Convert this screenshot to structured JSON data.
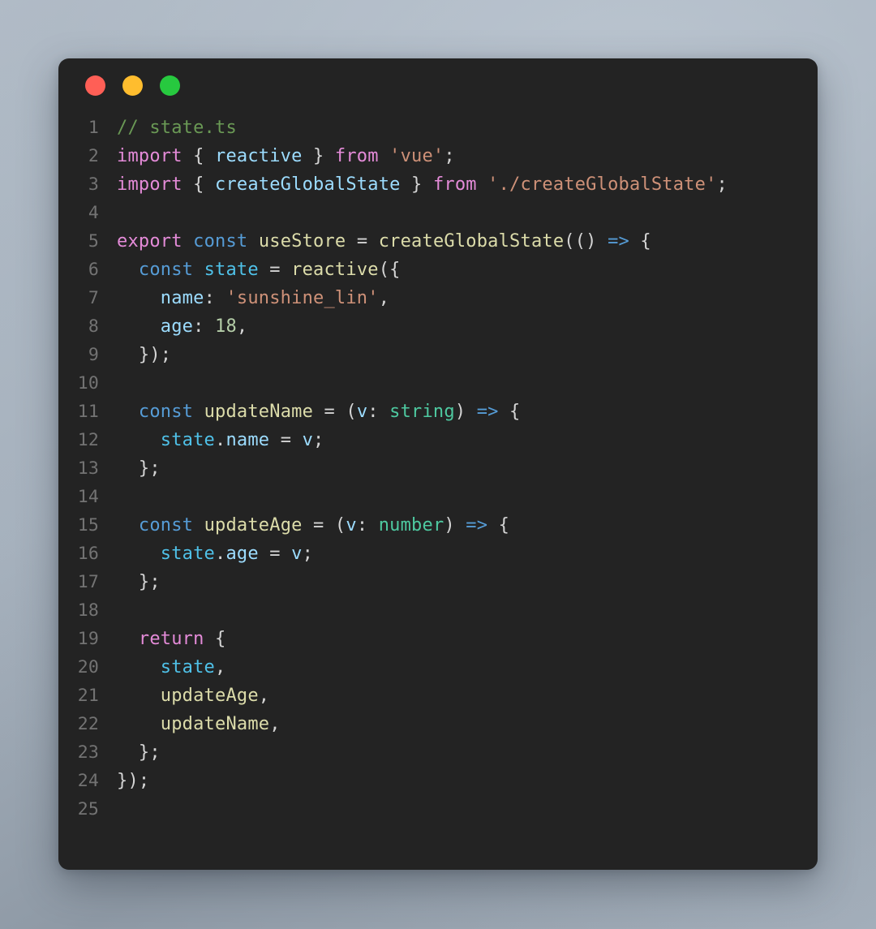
{
  "window": {
    "background_color": "#232323",
    "page_background_color": "#a8b4c0",
    "controls": [
      {
        "name": "close",
        "color": "#ff5f56"
      },
      {
        "name": "minimize",
        "color": "#ffbd2e"
      },
      {
        "name": "maximize",
        "color": "#27c93f"
      }
    ]
  },
  "editor": {
    "language": "typescript",
    "filename": "state.ts",
    "line_number_color": "#737373",
    "theme": {
      "comment": "#6a9955",
      "keyword": "#e48bd8",
      "storage": "#569cd6",
      "function": "#dcdcaa",
      "variable": "#9cdcfe",
      "variable_bright": "#4fc1e8",
      "string": "#ce9178",
      "number": "#b5cea8",
      "type": "#4ec9a0",
      "arrow": "#569cd6",
      "punctuation": "#d4d4d4"
    },
    "line_numbers": [
      "1",
      "2",
      "3",
      "4",
      "5",
      "6",
      "7",
      "8",
      "9",
      "10",
      "11",
      "12",
      "13",
      "14",
      "15",
      "16",
      "17",
      "18",
      "19",
      "20",
      "21",
      "22",
      "23",
      "24",
      "25"
    ],
    "lines": [
      {
        "n": "1",
        "text": "// state.ts"
      },
      {
        "n": "2",
        "text": "import { reactive } from 'vue';"
      },
      {
        "n": "3",
        "text": "import { createGlobalState } from './createGlobalState';"
      },
      {
        "n": "4",
        "text": ""
      },
      {
        "n": "5",
        "text": "export const useStore = createGlobalState(() => {"
      },
      {
        "n": "6",
        "text": "  const state = reactive({"
      },
      {
        "n": "7",
        "text": "    name: 'sunshine_lin',"
      },
      {
        "n": "8",
        "text": "    age: 18,"
      },
      {
        "n": "9",
        "text": "  });"
      },
      {
        "n": "10",
        "text": ""
      },
      {
        "n": "11",
        "text": "  const updateName = (v: string) => {"
      },
      {
        "n": "12",
        "text": "    state.name = v;"
      },
      {
        "n": "13",
        "text": "  };"
      },
      {
        "n": "14",
        "text": ""
      },
      {
        "n": "15",
        "text": "  const updateAge = (v: number) => {"
      },
      {
        "n": "16",
        "text": "    state.age = v;"
      },
      {
        "n": "17",
        "text": "  };"
      },
      {
        "n": "18",
        "text": ""
      },
      {
        "n": "19",
        "text": "  return {"
      },
      {
        "n": "20",
        "text": "    state,"
      },
      {
        "n": "21",
        "text": "    updateAge,"
      },
      {
        "n": "22",
        "text": "    updateName,"
      },
      {
        "n": "23",
        "text": "  };"
      },
      {
        "n": "24",
        "text": "});"
      },
      {
        "n": "25",
        "text": ""
      }
    ],
    "tokens": [
      [
        {
          "c": "comment",
          "t": "// state.ts"
        }
      ],
      [
        {
          "c": "keyword",
          "t": "import"
        },
        {
          "c": "punct",
          "t": " { "
        },
        {
          "c": "var",
          "t": "reactive"
        },
        {
          "c": "punct",
          "t": " } "
        },
        {
          "c": "keyword",
          "t": "from"
        },
        {
          "c": "punct",
          "t": " "
        },
        {
          "c": "string",
          "t": "'vue'"
        },
        {
          "c": "punct",
          "t": ";"
        }
      ],
      [
        {
          "c": "keyword",
          "t": "import"
        },
        {
          "c": "punct",
          "t": " { "
        },
        {
          "c": "var",
          "t": "createGlobalState"
        },
        {
          "c": "punct",
          "t": " } "
        },
        {
          "c": "keyword",
          "t": "from"
        },
        {
          "c": "punct",
          "t": " "
        },
        {
          "c": "string",
          "t": "'./createGlobalState'"
        },
        {
          "c": "punct",
          "t": ";"
        }
      ],
      [
        {
          "c": "punct",
          "t": ""
        }
      ],
      [
        {
          "c": "keyword",
          "t": "export"
        },
        {
          "c": "punct",
          "t": " "
        },
        {
          "c": "storage",
          "t": "const"
        },
        {
          "c": "punct",
          "t": " "
        },
        {
          "c": "func",
          "t": "useStore"
        },
        {
          "c": "punct",
          "t": " = "
        },
        {
          "c": "func",
          "t": "createGlobalState"
        },
        {
          "c": "punct",
          "t": "(() "
        },
        {
          "c": "arrow",
          "t": "=>"
        },
        {
          "c": "punct",
          "t": " {"
        }
      ],
      [
        {
          "c": "punct",
          "t": "  "
        },
        {
          "c": "storage",
          "t": "const"
        },
        {
          "c": "punct",
          "t": " "
        },
        {
          "c": "varb",
          "t": "state"
        },
        {
          "c": "punct",
          "t": " = "
        },
        {
          "c": "func",
          "t": "reactive"
        },
        {
          "c": "punct",
          "t": "({"
        }
      ],
      [
        {
          "c": "punct",
          "t": "    "
        },
        {
          "c": "var",
          "t": "name"
        },
        {
          "c": "punct",
          "t": ": "
        },
        {
          "c": "string",
          "t": "'sunshine_lin'"
        },
        {
          "c": "punct",
          "t": ","
        }
      ],
      [
        {
          "c": "punct",
          "t": "    "
        },
        {
          "c": "var",
          "t": "age"
        },
        {
          "c": "punct",
          "t": ": "
        },
        {
          "c": "number",
          "t": "18"
        },
        {
          "c": "punct",
          "t": ","
        }
      ],
      [
        {
          "c": "punct",
          "t": "  });"
        }
      ],
      [
        {
          "c": "punct",
          "t": ""
        }
      ],
      [
        {
          "c": "punct",
          "t": "  "
        },
        {
          "c": "storage",
          "t": "const"
        },
        {
          "c": "punct",
          "t": " "
        },
        {
          "c": "func",
          "t": "updateName"
        },
        {
          "c": "punct",
          "t": " = ("
        },
        {
          "c": "var",
          "t": "v"
        },
        {
          "c": "punct",
          "t": ": "
        },
        {
          "c": "type",
          "t": "string"
        },
        {
          "c": "punct",
          "t": ") "
        },
        {
          "c": "arrow",
          "t": "=>"
        },
        {
          "c": "punct",
          "t": " {"
        }
      ],
      [
        {
          "c": "punct",
          "t": "    "
        },
        {
          "c": "varb",
          "t": "state"
        },
        {
          "c": "punct",
          "t": "."
        },
        {
          "c": "var",
          "t": "name"
        },
        {
          "c": "punct",
          "t": " = "
        },
        {
          "c": "var",
          "t": "v"
        },
        {
          "c": "punct",
          "t": ";"
        }
      ],
      [
        {
          "c": "punct",
          "t": "  };"
        }
      ],
      [
        {
          "c": "punct",
          "t": ""
        }
      ],
      [
        {
          "c": "punct",
          "t": "  "
        },
        {
          "c": "storage",
          "t": "const"
        },
        {
          "c": "punct",
          "t": " "
        },
        {
          "c": "func",
          "t": "updateAge"
        },
        {
          "c": "punct",
          "t": " = ("
        },
        {
          "c": "var",
          "t": "v"
        },
        {
          "c": "punct",
          "t": ": "
        },
        {
          "c": "type",
          "t": "number"
        },
        {
          "c": "punct",
          "t": ") "
        },
        {
          "c": "arrow",
          "t": "=>"
        },
        {
          "c": "punct",
          "t": " {"
        }
      ],
      [
        {
          "c": "punct",
          "t": "    "
        },
        {
          "c": "varb",
          "t": "state"
        },
        {
          "c": "punct",
          "t": "."
        },
        {
          "c": "var",
          "t": "age"
        },
        {
          "c": "punct",
          "t": " = "
        },
        {
          "c": "var",
          "t": "v"
        },
        {
          "c": "punct",
          "t": ";"
        }
      ],
      [
        {
          "c": "punct",
          "t": "  };"
        }
      ],
      [
        {
          "c": "punct",
          "t": ""
        }
      ],
      [
        {
          "c": "punct",
          "t": "  "
        },
        {
          "c": "keyword",
          "t": "return"
        },
        {
          "c": "punct",
          "t": " {"
        }
      ],
      [
        {
          "c": "punct",
          "t": "    "
        },
        {
          "c": "varb",
          "t": "state"
        },
        {
          "c": "punct",
          "t": ","
        }
      ],
      [
        {
          "c": "punct",
          "t": "    "
        },
        {
          "c": "func",
          "t": "updateAge"
        },
        {
          "c": "punct",
          "t": ","
        }
      ],
      [
        {
          "c": "punct",
          "t": "    "
        },
        {
          "c": "func",
          "t": "updateName"
        },
        {
          "c": "punct",
          "t": ","
        }
      ],
      [
        {
          "c": "punct",
          "t": "  };"
        }
      ],
      [
        {
          "c": "punct",
          "t": "});"
        }
      ],
      [
        {
          "c": "punct",
          "t": ""
        }
      ]
    ]
  }
}
